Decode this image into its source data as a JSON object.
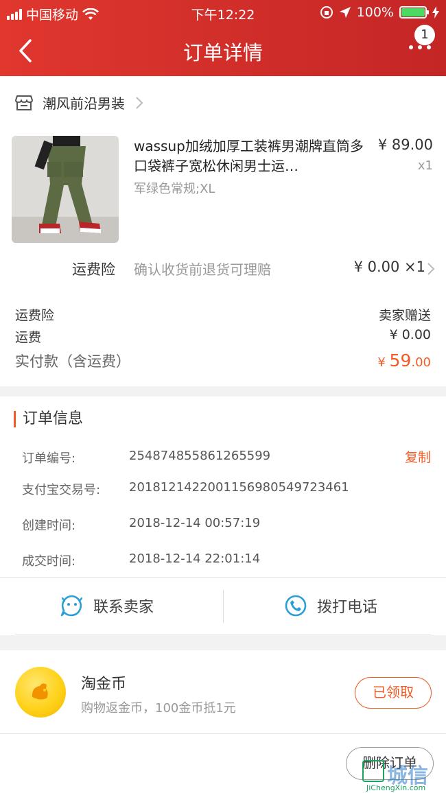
{
  "status_bar": {
    "carrier": "中国移动",
    "time": "下午12:22",
    "battery": "100%"
  },
  "nav": {
    "title": "订单详情",
    "badge": "1"
  },
  "shop": {
    "name": "潮风前沿男装"
  },
  "product": {
    "title": "wassup加绒加厚工装裤男潮牌直筒多口袋裤子宽松休闲男士运…",
    "sku": "军绿色常规;XL",
    "price": "¥ 89.00",
    "qty": "x1"
  },
  "insurance": {
    "label": "运费险",
    "desc": "确认收货前退货可理赔",
    "value": "¥ 0.00 ×1"
  },
  "summary": {
    "rows": [
      {
        "label": "运费险",
        "value": "卖家赠送"
      },
      {
        "label": "运费",
        "value": "¥ 0.00"
      }
    ],
    "total_label": "实付款（含运费）",
    "total_currency": "¥ ",
    "total_int": "59",
    "total_dec": ".00"
  },
  "order_info": {
    "title": "订单信息",
    "copy_label": "复制",
    "items": [
      {
        "label": "订单编号:",
        "value": "254874855861265599"
      },
      {
        "label": "支付宝交易号:",
        "value": "2018121422001156980549723461"
      },
      {
        "label": "创建时间:",
        "value": "2018-12-14 00:57:19"
      },
      {
        "label": "成交时间:",
        "value": "2018-12-14 22:01:14"
      }
    ],
    "contact_seller": "联系卖家",
    "call_phone": "拨打电话"
  },
  "coin": {
    "title": "淘金币",
    "subtitle": "购物返金币，100金币抵1元",
    "button": "已领取"
  },
  "actions": {
    "delete_order": "删除订单"
  },
  "watermark": {
    "line1": "城信",
    "line2": "JiChengXin.com"
  },
  "colors": {
    "header": "#d52e28",
    "accent": "#f15a24",
    "call_blue": "#2a9fd6"
  }
}
